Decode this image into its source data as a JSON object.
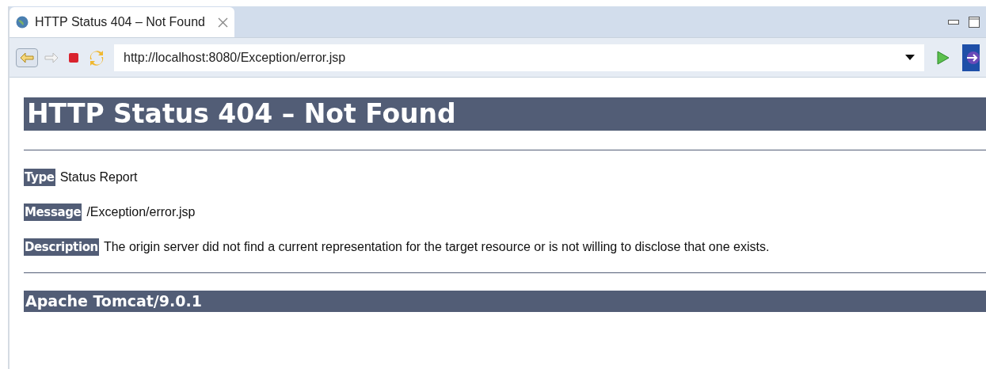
{
  "tabs": [
    {
      "title": "HTTP Status 404 – Not Found",
      "selected": true
    }
  ],
  "address_bar": {
    "value": "http://localhost:8080/Exception/error.jsp"
  },
  "page": {
    "heading": "HTTP Status 404 – Not Found",
    "fields": [
      {
        "label": "Type",
        "value": "Status Report"
      },
      {
        "label": "Message",
        "value": "/Exception/error.jsp"
      },
      {
        "label": "Description",
        "value": "The origin server did not find a current representation for the target resource or is not willing to disclose that one exists."
      }
    ],
    "footer": "Apache Tomcat/9.0.1"
  }
}
